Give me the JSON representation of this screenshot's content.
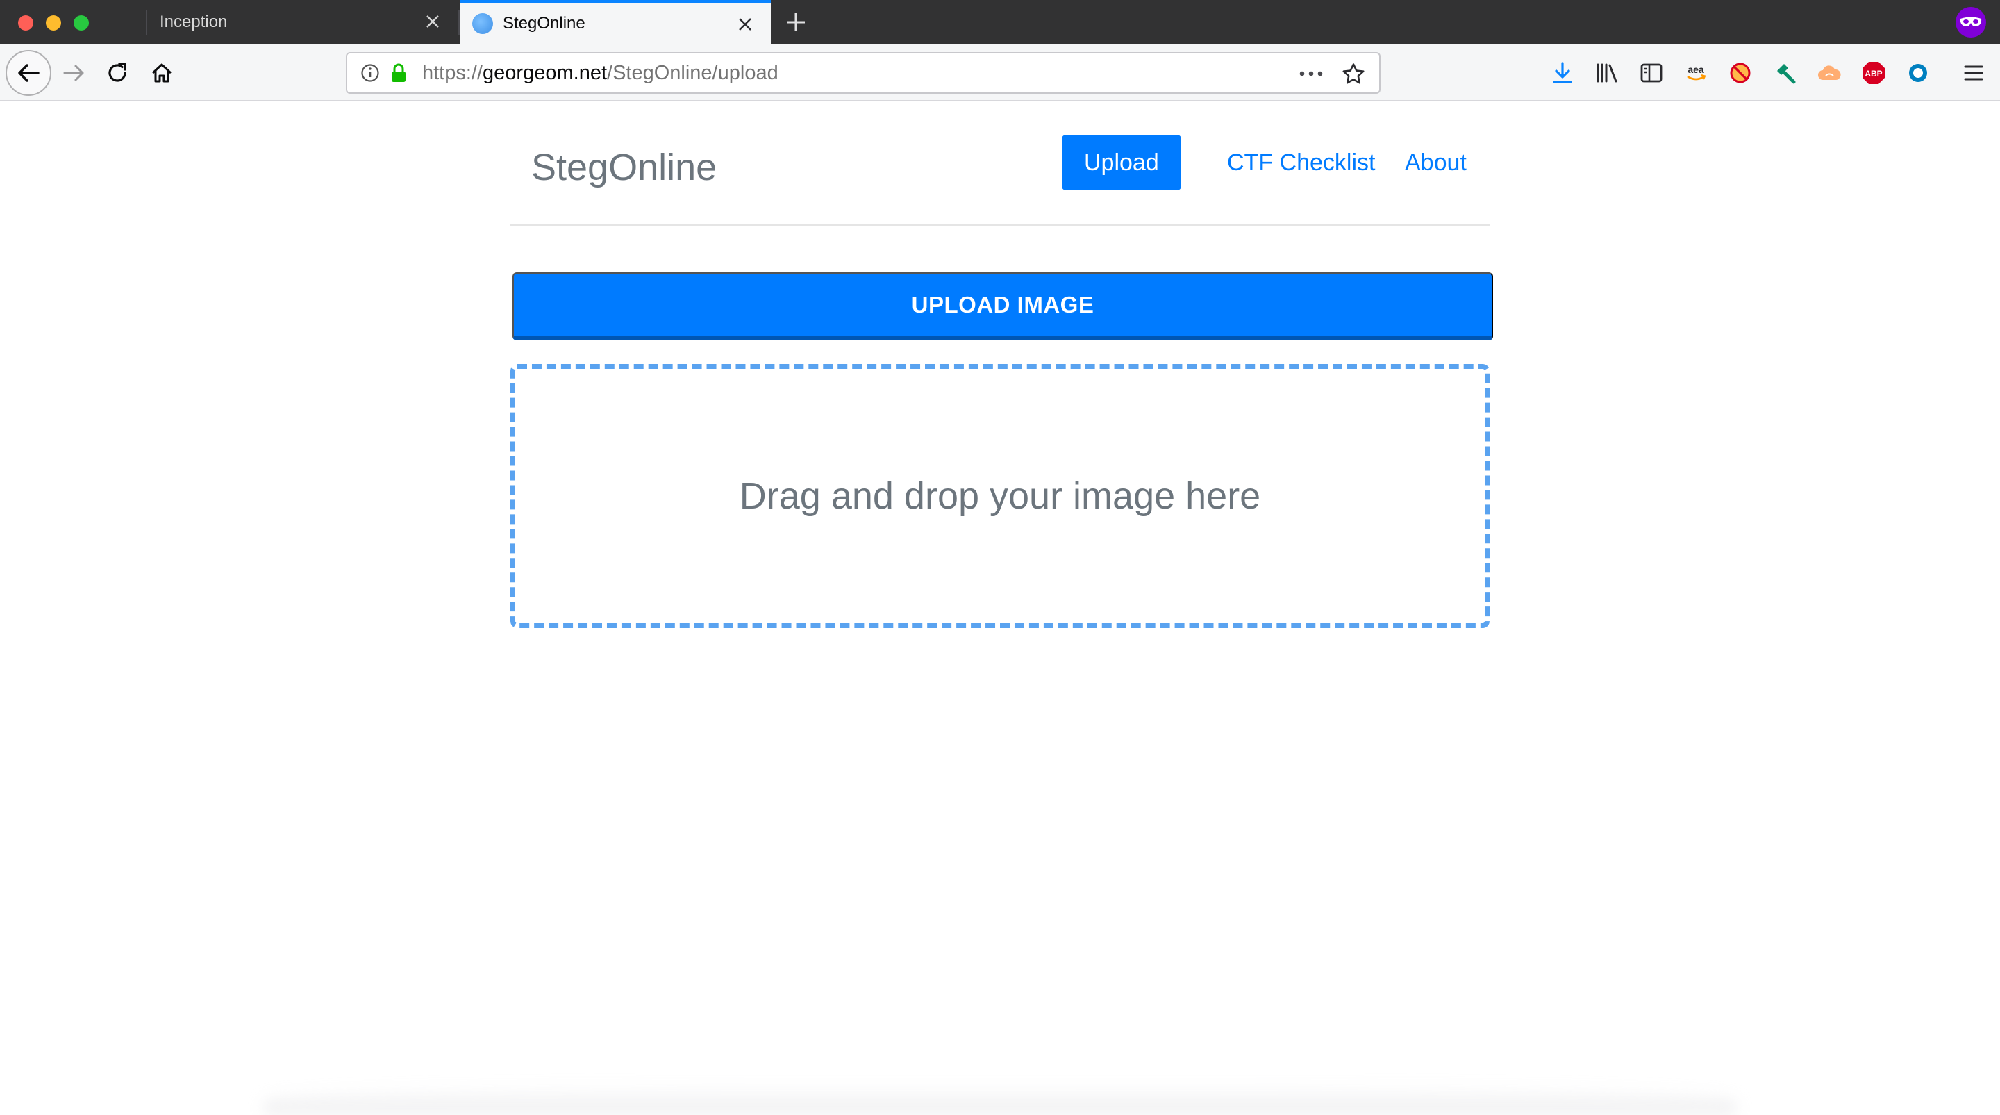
{
  "browser": {
    "tabs": [
      {
        "title": "Inception",
        "active": false
      },
      {
        "title": "StegOnline",
        "active": true
      }
    ],
    "url": {
      "prefix": "https://",
      "domain": "georgeom.net",
      "path": "/StegOnline/upload"
    },
    "toolbar_icons": [
      "download-icon",
      "library-icon",
      "sidebar-icon",
      "amazon-extension-icon",
      "no-ads-extension-icon",
      "hammer-extension-icon",
      "cloud-extension-icon",
      "adblock-plus-icon",
      "circle-extension-icon",
      "menu-icon"
    ],
    "adblock_label": "ABP",
    "amazon_label": "aea",
    "colors": {
      "tab_strip": "#323233",
      "active_tab_accent": "#0a84ff",
      "private_badge": "#8000d7"
    }
  },
  "site": {
    "brand": "StegOnline",
    "nav": [
      {
        "label": "Upload",
        "active": true
      },
      {
        "label": "CTF Checklist",
        "active": false
      },
      {
        "label": "About",
        "active": false
      }
    ],
    "upload_button_label": "UPLOAD IMAGE",
    "dropzone_text": "Drag and drop your image here",
    "colors": {
      "primary": "#007bff",
      "dropzone_border": "#5aa3f0",
      "muted_text": "#6c757d"
    }
  }
}
